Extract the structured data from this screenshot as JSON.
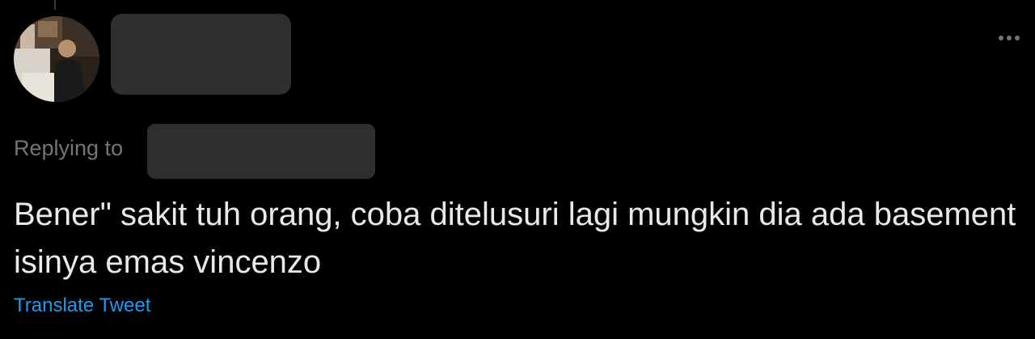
{
  "tweet": {
    "replying_label": "Replying to",
    "text": "Bener\" sakit tuh orang, coba ditelusuri lagi mungkin dia ada basement isinya emas vincenzo",
    "translate_label": "Translate Tweet"
  },
  "icons": {
    "more": "more-horizontal-icon",
    "avatar": "user-avatar"
  },
  "colors": {
    "background": "#000000",
    "text_primary": "#e7e9ea",
    "text_secondary": "#71767b",
    "link": "#1d9bf0",
    "redaction": "#2f2f2f"
  }
}
